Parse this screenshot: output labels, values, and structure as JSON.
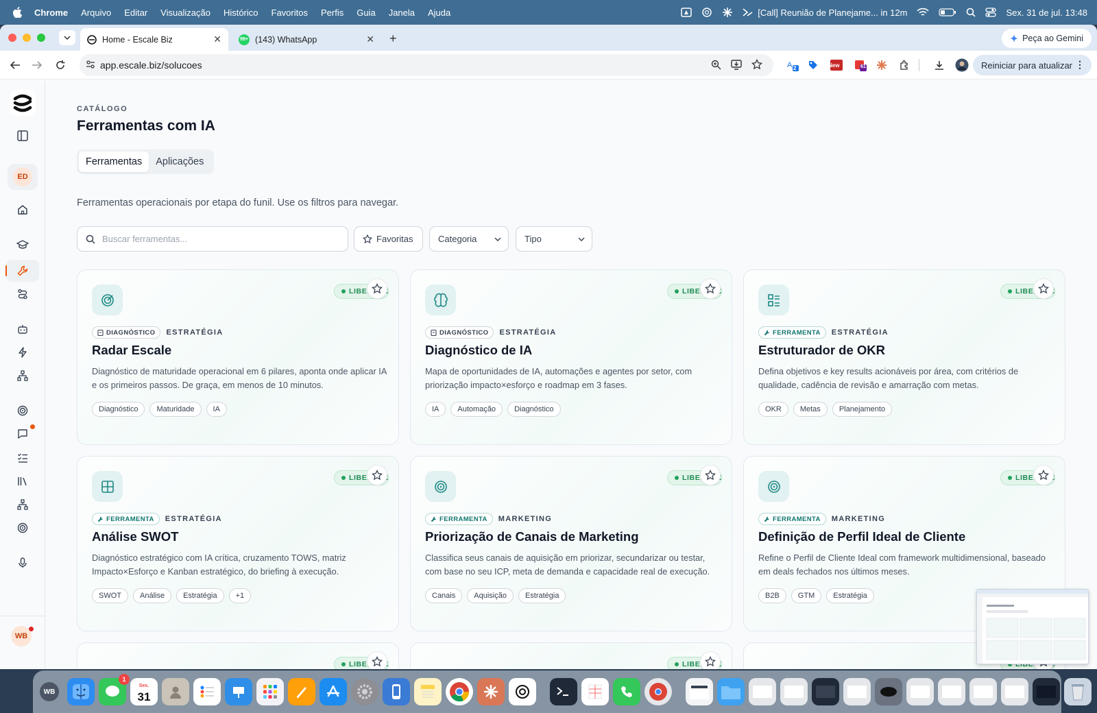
{
  "menubar": {
    "app": "Chrome",
    "items": [
      "Arquivo",
      "Editar",
      "Visualização",
      "Histórico",
      "Favoritos",
      "Perfis",
      "Guia",
      "Janela",
      "Ajuda"
    ],
    "meeting": "[Call] Reunião de Planejame... in 12m",
    "datetime": "Sex. 31 de jul.  13:48"
  },
  "browser": {
    "tabs": [
      {
        "label": "Home - Escale Biz",
        "active": true
      },
      {
        "label": "(143) WhatsApp",
        "active": false
      }
    ],
    "whatsapp_badge": "99+",
    "gemini_label": "Peça ao Gemini",
    "url": "app.escale.biz/solucoes",
    "update_label": "Reiniciar para atualizar",
    "ext_badges": {
      "first": "2",
      "new": "New",
      "third": "61"
    }
  },
  "sidebar": {
    "avatar_top": "ED",
    "avatar_bottom": "WB"
  },
  "page": {
    "eyebrow": "CATÁLOGO",
    "title": "Ferramentas com IA",
    "tabs": [
      "Ferramentas",
      "Aplicações"
    ],
    "description": "Ferramentas operacionais por etapa do funil. Use os filtros para navegar.",
    "search_placeholder": "Buscar ferramentas...",
    "filters": {
      "favorites": "Favoritas",
      "category": "Categoria",
      "type": "Tipo"
    }
  },
  "cards": [
    {
      "badge": "LIBERADO",
      "type": "DIAGNÓSTICO",
      "category": "ESTRATÉGIA",
      "title": "Radar Escale",
      "description": "Diagnóstico de maturidade operacional em 6 pilares, aponta onde aplicar IA e os primeiros passos. De graça, em menos de 10 minutos.",
      "tags": [
        "Diagnóstico",
        "Maturidade",
        "IA"
      ],
      "icon": "radar-icon"
    },
    {
      "badge": "LIBERADO",
      "type": "DIAGNÓSTICO",
      "category": "ESTRATÉGIA",
      "title": "Diagnóstico de IA",
      "description": "Mapa de oportunidades de IA, automações e agentes por setor, com priorização impacto×esforço e roadmap em 3 fases.",
      "tags": [
        "IA",
        "Automação",
        "Diagnóstico"
      ],
      "icon": "brain-icon"
    },
    {
      "badge": "LIBERADO",
      "type": "FERRAMENTA",
      "category": "ESTRATÉGIA",
      "title": "Estruturador de OKR",
      "description": "Defina objetivos e key results acionáveis por área, com critérios de qualidade, cadência de revisão e amarração com metas.",
      "tags": [
        "OKR",
        "Metas",
        "Planejamento"
      ],
      "icon": "list-icon"
    },
    {
      "badge": "LIBERADO",
      "type": "FERRAMENTA",
      "category": "ESTRATÉGIA",
      "title": "Análise SWOT",
      "description": "Diagnóstico estratégico com IA crítica, cruzamento TOWS, matriz Impacto×Esforço e Kanban estratégico, do briefing à execução.",
      "tags": [
        "SWOT",
        "Análise",
        "Estratégia",
        "+1"
      ],
      "icon": "grid-icon"
    },
    {
      "badge": "LIBERADO",
      "type": "FERRAMENTA",
      "category": "MARKETING",
      "title": "Priorização de Canais de Marketing",
      "description": "Classifica seus canais de aquisição em priorizar, secundarizar ou testar, com base no seu ICP, meta de demanda e capacidade real de execução.",
      "tags": [
        "Canais",
        "Aquisição",
        "Estratégia"
      ],
      "icon": "target-icon"
    },
    {
      "badge": "LIBERADO",
      "type": "FERRAMENTA",
      "category": "MARKETING",
      "title": "Definição de Perfil Ideal de Cliente",
      "description": "Refine o Perfil de Cliente Ideal com framework multidimensional, baseado em deals fechados nos últimos meses.",
      "tags": [
        "B2B",
        "GTM",
        "Estratégia"
      ],
      "icon": "target-icon"
    }
  ],
  "peek_cards": [
    {
      "badge": "LIBERADO"
    },
    {
      "badge": "LIBERADO"
    },
    {
      "badge": "LIBERADO"
    }
  ],
  "dock": {
    "calendar_day": "31",
    "calendar_month": "Sex.",
    "messages_badge": "1",
    "user_initials": "WB"
  },
  "colors": {
    "accent": "#1e8a85",
    "badge_green": "#22a15e",
    "menubar": "#3f6d93"
  }
}
